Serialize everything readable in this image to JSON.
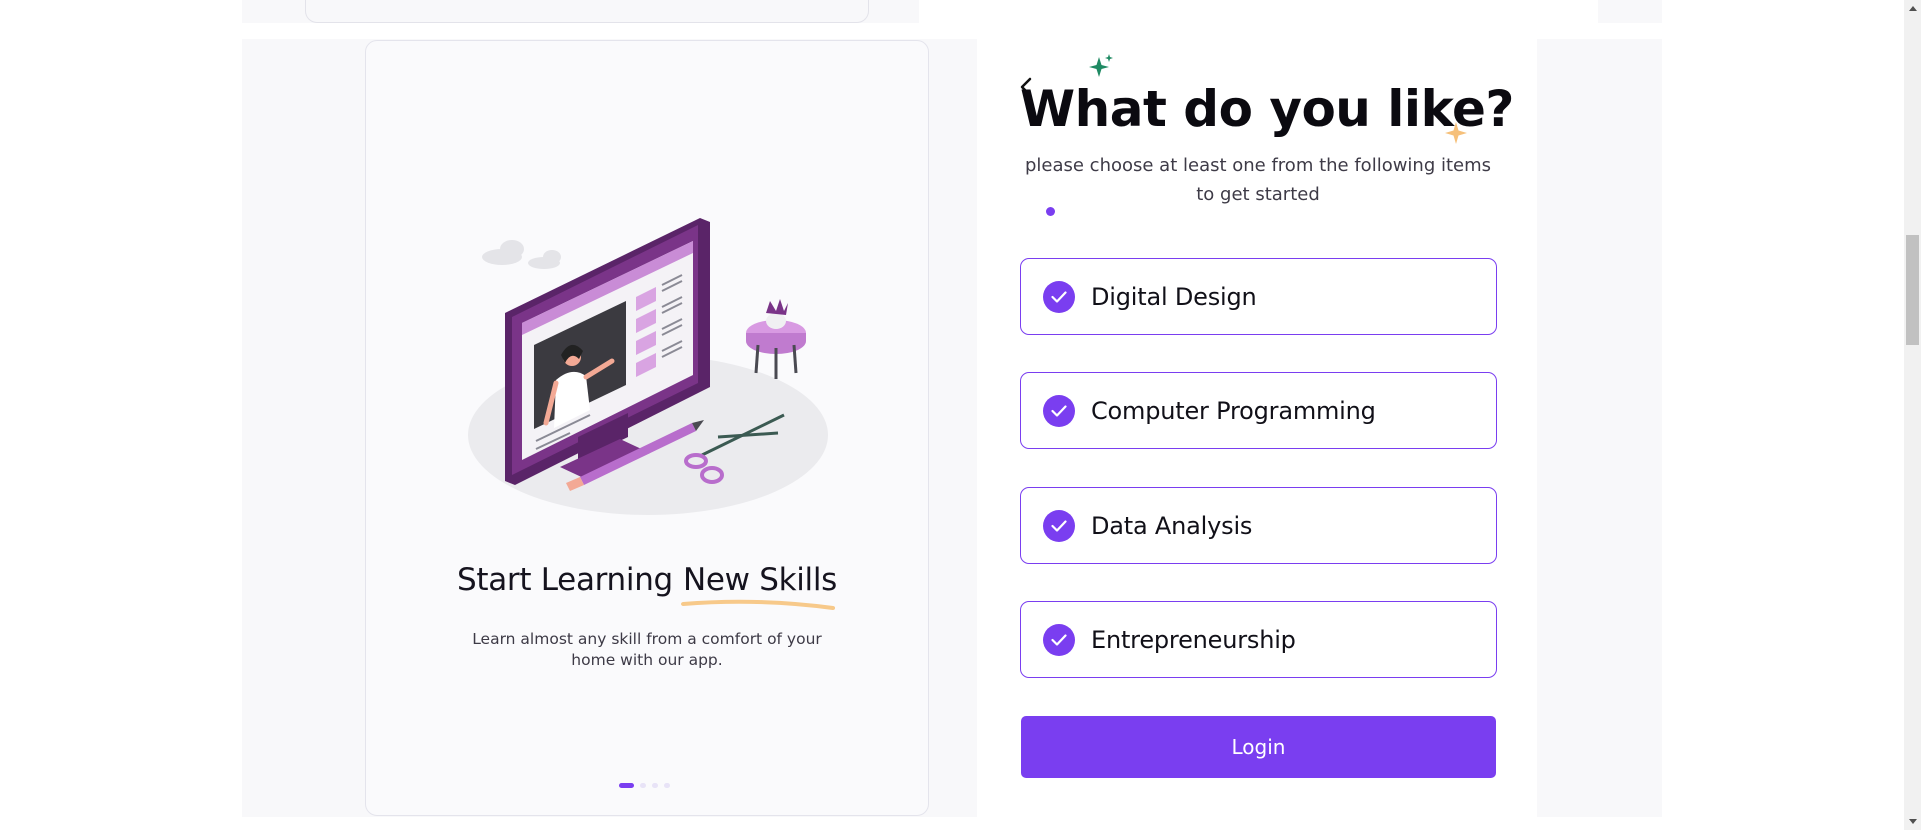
{
  "onboarding": {
    "title_part1": "Start Learning",
    "title_highlight": "New Skills",
    "description": "Learn almost any skill from a comfort of your home with our app.",
    "carousel": {
      "total_slides": 4,
      "active_index": 0
    },
    "illustration_icon": "online-learning-illustration"
  },
  "form": {
    "back_icon": "chevron-left-icon",
    "title": "What do you like?",
    "subtitle": "please choose at least one from the following items to get started",
    "options": [
      {
        "label": "Digital Design",
        "selected": true
      },
      {
        "label": "Computer Programming",
        "selected": true
      },
      {
        "label": "Data Analysis",
        "selected": true
      },
      {
        "label": "Entrepreneurship",
        "selected": true
      }
    ],
    "login_label": "Login"
  },
  "colors": {
    "accent": "#7a3ef0",
    "sparkle_green": "#1f8a63",
    "sparkle_orange": "#f6c07a",
    "underline": "#f7c98a",
    "text_dark": "#0b0a10"
  }
}
